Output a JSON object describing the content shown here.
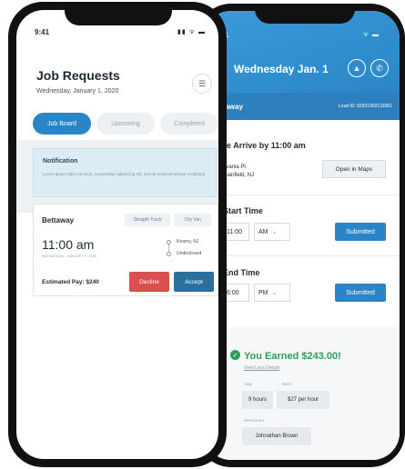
{
  "front_screen": {
    "status_time": "9:41",
    "status_icons": "▮▮ ᯤ ▬",
    "title": "Job Requests",
    "subtitle": "Wednesday, January 1, 2020",
    "filter_icon": "sliders-icon",
    "tabs": [
      {
        "label": "Job Board",
        "active": true
      },
      {
        "label": "Upcoming",
        "active": false
      },
      {
        "label": "Completed",
        "active": false
      }
    ],
    "notification": {
      "title": "Notification",
      "body": "Lorem ipsum dolor sit amet, consectetur adipiscing elit, sed do eiusmod tempor incididunt."
    },
    "job": {
      "company": "Bettaway",
      "tags": [
        "Straight Truck",
        "Dry Van"
      ],
      "time": "11:00 am",
      "date": "WEDNESDAY, JANUARY 1, 2020",
      "origin": "Kearny, NJ",
      "destination": "Undisclosed",
      "estimated_pay": "Estimated Pay: $240",
      "decline_label": "Decline",
      "accept_label": "Accept"
    }
  },
  "back_screen": {
    "status_time": "41",
    "status_icons": "ᯤ ▬",
    "date": "Wednesday Jan. 1",
    "company": "ttaway",
    "load_id": "Load ID: 92931902132361",
    "arrive_title": "ease Arrive by 11:00 am",
    "address_line1": "Sylvania Pl.",
    "address_line2": "uth Plainfield, NJ",
    "open_maps_label": "Open in Maps",
    "shift_start": {
      "title": "ift Start Time",
      "hour": "11:00",
      "ampm": "AM",
      "button": "Submitted"
    },
    "shift_end": {
      "title": "ift End Time",
      "hour": "6:00",
      "ampm": "PM",
      "button": "Submitted"
    },
    "earned": {
      "title": "You Earned $243.00!",
      "link": "View Less Details",
      "label_time": "TIME",
      "label_rate": "RATE",
      "time_value": "9 hours",
      "rate_value": "$27 per hour",
      "label_person": "APPROVER",
      "person": "Johnathan Brown"
    }
  }
}
